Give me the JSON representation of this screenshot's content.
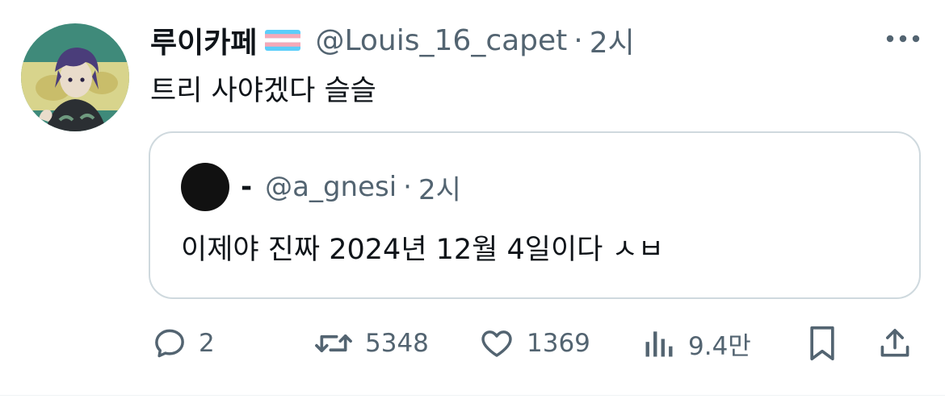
{
  "tweet": {
    "display_name": "루이카페",
    "handle": "@Louis_16_capet",
    "separator": "·",
    "time": "2시",
    "text": "트리 사야겠다 슬슬"
  },
  "quoted_tweet": {
    "display_name": "-",
    "handle": "@a_gnesi",
    "separator": "·",
    "time": "2시",
    "text": "이제야 진짜 2024년 12월 4일이다 ㅅㅂ"
  },
  "actions": {
    "reply_count": "2",
    "retweet_count": "5348",
    "like_count": "1369",
    "view_count": "9.4만"
  },
  "icons": [
    "more-icon",
    "reply-icon",
    "retweet-icon",
    "like-icon",
    "views-icon",
    "bookmark-icon",
    "share-icon"
  ],
  "colors": {
    "text_primary": "#0f1419",
    "text_secondary": "#536471",
    "border": "#cfd9de"
  }
}
